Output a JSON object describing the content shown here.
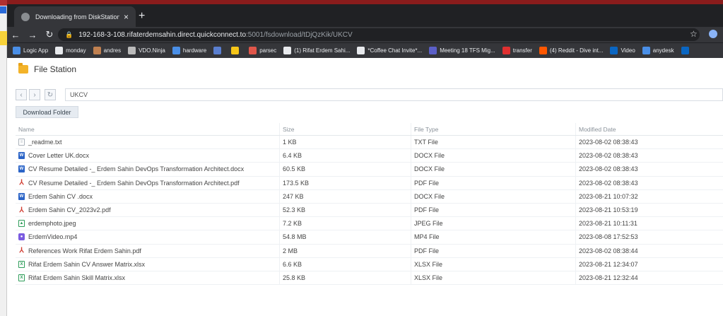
{
  "browser": {
    "tab_title": "Downloading from DiskStation",
    "tab_close": "×",
    "new_tab": "+",
    "url_main": "192-168-3-108.rifaterdemsahin.direct.quickconnect.to",
    "url_rest": ":5001/fsdownload/tDjQzKik/UKCV",
    "bookmarks": [
      {
        "label": "Logic App",
        "color": "#4a8fe7"
      },
      {
        "label": "monday",
        "color": "#e8eaed"
      },
      {
        "label": "andres",
        "color": "#c08050"
      },
      {
        "label": "VDO.Ninja",
        "color": "#bbb"
      },
      {
        "label": "hardware",
        "color": "#4a8fe7"
      },
      {
        "label": "",
        "color": "#5a7fd0"
      },
      {
        "label": "",
        "color": "#f5c518"
      },
      {
        "label": "parsec",
        "color": "#e0564a"
      },
      {
        "label": "(1) Rifat Erdem Sahi...",
        "color": "#e8eaed"
      },
      {
        "label": "*Coffee Chat Invite*...",
        "color": "#e8eaed"
      },
      {
        "label": "Meeting 18 TFS Mig...",
        "color": "#5b5fc7"
      },
      {
        "label": "transfer",
        "color": "#e03030"
      },
      {
        "label": "(4) Reddit - Dive int...",
        "color": "#ff5700"
      },
      {
        "label": "Video",
        "color": "#0a66c2"
      },
      {
        "label": "anydesk",
        "color": "#4a8fe7"
      },
      {
        "label": "",
        "color": "#0a66c2"
      }
    ]
  },
  "filestation": {
    "title": "File Station",
    "path": "UKCV",
    "download_folder_label": "Download Folder",
    "columns": [
      "Name",
      "Size",
      "File Type",
      "Modified Date"
    ],
    "files": [
      {
        "name": "_readme.txt",
        "size": "1 KB",
        "type": "TXT File",
        "modified": "2023-08-02 08:38:43",
        "icon": "txt"
      },
      {
        "name": "Cover Letter UK.docx",
        "size": "6.4 KB",
        "type": "DOCX File",
        "modified": "2023-08-02 08:38:43",
        "icon": "docx"
      },
      {
        "name": "CV Resume Detailed -_ Erdem Sahin DevOps Transformation Architect.docx",
        "size": "60.5 KB",
        "type": "DOCX File",
        "modified": "2023-08-02 08:38:43",
        "icon": "docx"
      },
      {
        "name": "CV Resume Detailed -_ Erdem Sahin DevOps Transformation Architect.pdf",
        "size": "173.5 KB",
        "type": "PDF File",
        "modified": "2023-08-02 08:38:43",
        "icon": "pdf"
      },
      {
        "name": "Erdem Sahin CV .docx",
        "size": "247 KB",
        "type": "DOCX File",
        "modified": "2023-08-21 10:07:32",
        "icon": "docx"
      },
      {
        "name": "Erdem Sahin CV_2023v2.pdf",
        "size": "52.3 KB",
        "type": "PDF File",
        "modified": "2023-08-21 10:53:19",
        "icon": "pdf"
      },
      {
        "name": "erdemphoto.jpeg",
        "size": "7.2 KB",
        "type": "JPEG File",
        "modified": "2023-08-21 10:11:31",
        "icon": "jpeg"
      },
      {
        "name": "ErdemVideo.mp4",
        "size": "54.8 MB",
        "type": "MP4 File",
        "modified": "2023-08-08 17:52:53",
        "icon": "mp4"
      },
      {
        "name": "References Work Rifat Erdem Sahin.pdf",
        "size": "2 MB",
        "type": "PDF File",
        "modified": "2023-08-02 08:38:44",
        "icon": "pdf"
      },
      {
        "name": "Rifat Erdem Sahin CV Answer Matrix.xlsx",
        "size": "6.6 KB",
        "type": "XLSX File",
        "modified": "2023-08-21 12:34:07",
        "icon": "xlsx"
      },
      {
        "name": "Rifat Erdem Sahin Skill Matrix.xlsx",
        "size": "25.8 KB",
        "type": "XLSX File",
        "modified": "2023-08-21 12:32:44",
        "icon": "xlsx"
      }
    ]
  }
}
